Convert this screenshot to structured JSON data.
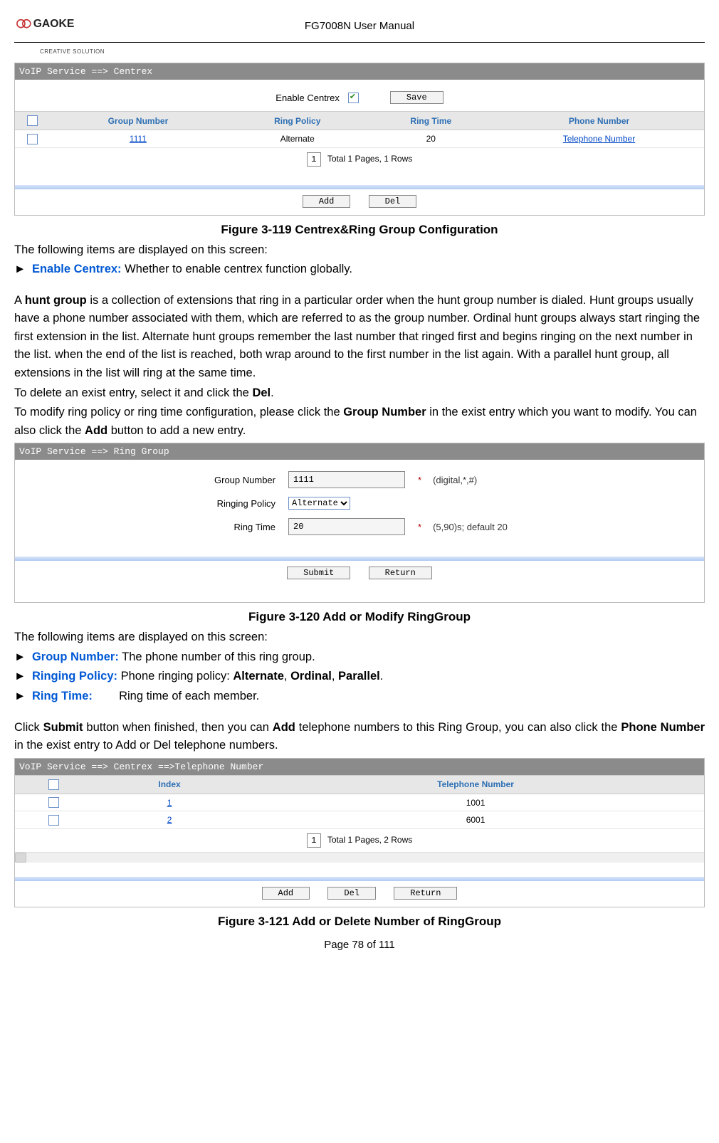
{
  "header": {
    "brand_primary": "GAOKE",
    "brand_tagline": "CREATIVE SOLUTION",
    "doc_title": "FG7008N User Manual"
  },
  "footer": {
    "page_of": "Page 78 of 111"
  },
  "fig1": {
    "caption": "Figure 3-119  Centrex&Ring Group Configuration",
    "titlebar": "VoIP Service ==> Centrex",
    "enable_label": "Enable Centrex",
    "save_btn": "Save",
    "cols": {
      "c1": "Group Number",
      "c2": "Ring Policy",
      "c3": "Ring Time",
      "c4": "Phone Number"
    },
    "row": {
      "grp": "1111",
      "policy": "Alternate",
      "time": "20",
      "phone": "Telephone Number"
    },
    "pager": {
      "num": "1",
      "text": "Total 1 Pages, 1 Rows"
    },
    "add_btn": "Add",
    "del_btn": "Del"
  },
  "text1": {
    "intro": "The following items are displayed on this screen:",
    "enable_label": "Enable Centrex:",
    "enable_desc": " Whether to enable centrex function globally.",
    "huntgroup_intro_a": "A ",
    "huntgroup_term": "hunt group",
    "huntgroup_intro_b": " is a collection of extensions that ring in a particular order when the hunt group number is dialed. Hunt groups usually have a phone number associated with them, which are referred to as the group number. Ordinal hunt groups always start ringing the first extension in the list. Alternate hunt groups remember the last number that ringed first and begins ringing on the next number in the list. when the end of the list is reached, both wrap around to the first number in the list again. With a parallel hunt group, all extensions in the list will ring at the same time.",
    "del_line_a": "To delete an exist entry, select it and click the ",
    "del_line_b": "Del",
    "del_line_c": ".",
    "mod_line_a": "To modify ring policy or ring time configuration, please click the ",
    "mod_line_b": "Group Number",
    "mod_line_c": " in the exist entry which you want to modify. You can also click the ",
    "mod_line_d": "Add",
    "mod_line_e": " button to add a new entry."
  },
  "fig2": {
    "caption": "Figure 3-120 Add or Modify RingGroup",
    "titlebar": "VoIP Service ==> Ring Group",
    "labels": {
      "group": "Group Number",
      "policy": "Ringing Policy",
      "time": "Ring Time"
    },
    "values": {
      "group": "1111",
      "policy": "Alternate",
      "time": "20"
    },
    "hints": {
      "group": "(digital,*,#)",
      "time": "(5,90)s; default 20"
    },
    "submit_btn": "Submit",
    "return_btn": "Return"
  },
  "text2": {
    "intro": "The following items are displayed on this screen:",
    "group_label": "Group Number:",
    "group_desc": " The phone number of this ring group.",
    "policy_label": "Ringing Policy:",
    "policy_desc_a": " Phone ringing policy: ",
    "policy_alt": "Alternate",
    "policy_sep": ", ",
    "policy_ord": "Ordinal",
    "policy_par": "Parallel",
    "policy_end": ".",
    "time_label": "Ring Time:",
    "time_desc": "Ring time of each member.",
    "submit_a": "Click ",
    "submit_b": "Submit",
    "submit_c": " button when finished, then you can ",
    "submit_d": "Add",
    "submit_e": " telephone numbers to this Ring Group, you can also click the ",
    "submit_f": "Phone Number",
    "submit_g": " in the exist entry to Add or Del telephone numbers."
  },
  "fig3": {
    "caption": "Figure 3-121 Add or Delete Number of RingGroup",
    "titlebar": "VoIP Service ==> Centrex ==>Telephone Number",
    "cols": {
      "c1": "Index",
      "c2": "Telephone Number"
    },
    "rows": [
      {
        "idx": "1",
        "num": "1001"
      },
      {
        "idx": "2",
        "num": "6001"
      }
    ],
    "pager": {
      "num": "1",
      "text": "Total 1 Pages, 2 Rows"
    },
    "add_btn": "Add",
    "del_btn": "Del",
    "return_btn": "Return"
  }
}
